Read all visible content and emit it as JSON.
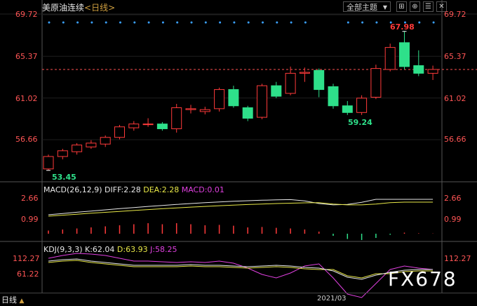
{
  "header": {
    "instrument": "美原油连续",
    "period": "<日线>",
    "theme_select": "全部主题",
    "tool_icons": [
      "grid-icon",
      "pin-icon",
      "list-icon",
      "close-icon"
    ]
  },
  "price_axis": {
    "left": [
      "69.72",
      "65.37",
      "61.02",
      "56.66"
    ],
    "right": [
      "69.72",
      "65.37",
      "61.02",
      "56.66"
    ]
  },
  "chart_data": {
    "type": "candlestick",
    "last_price_line": 64.0,
    "ylim": [
      51.0,
      69.72
    ],
    "annotations": {
      "high": "67.98",
      "low_1": "53.45",
      "low_2": "59.24"
    },
    "candles": [
      {
        "o": 53.6,
        "c": 54.9,
        "h": 55.1,
        "l": 53.45,
        "up": true
      },
      {
        "o": 54.9,
        "c": 55.5,
        "h": 55.7,
        "l": 54.6,
        "up": true
      },
      {
        "o": 55.4,
        "c": 56.1,
        "h": 56.3,
        "l": 55.1,
        "up": true
      },
      {
        "o": 55.9,
        "c": 56.3,
        "h": 56.6,
        "l": 55.7,
        "up": true
      },
      {
        "o": 56.2,
        "c": 56.9,
        "h": 57.1,
        "l": 55.9,
        "up": true
      },
      {
        "o": 56.9,
        "c": 58.0,
        "h": 58.2,
        "l": 56.7,
        "up": true
      },
      {
        "o": 57.9,
        "c": 58.3,
        "h": 58.6,
        "l": 57.6,
        "up": true
      },
      {
        "o": 58.3,
        "c": 58.3,
        "h": 58.9,
        "l": 58.0,
        "up": true
      },
      {
        "o": 58.3,
        "c": 57.8,
        "h": 58.5,
        "l": 57.6,
        "up": false
      },
      {
        "o": 57.8,
        "c": 60.0,
        "h": 60.4,
        "l": 57.4,
        "up": true
      },
      {
        "o": 59.8,
        "c": 59.9,
        "h": 60.3,
        "l": 59.4,
        "up": true
      },
      {
        "o": 59.6,
        "c": 59.8,
        "h": 60.1,
        "l": 59.3,
        "up": true
      },
      {
        "o": 59.9,
        "c": 61.9,
        "h": 62.1,
        "l": 59.6,
        "up": true
      },
      {
        "o": 61.9,
        "c": 60.2,
        "h": 62.3,
        "l": 60.0,
        "up": false
      },
      {
        "o": 60.0,
        "c": 58.9,
        "h": 60.2,
        "l": 58.6,
        "up": false
      },
      {
        "o": 59.0,
        "c": 62.3,
        "h": 62.5,
        "l": 58.8,
        "up": true
      },
      {
        "o": 62.3,
        "c": 61.2,
        "h": 62.7,
        "l": 61.0,
        "up": false
      },
      {
        "o": 61.5,
        "c": 63.6,
        "h": 64.3,
        "l": 61.3,
        "up": true
      },
      {
        "o": 63.6,
        "c": 63.7,
        "h": 64.2,
        "l": 62.7,
        "up": true
      },
      {
        "o": 63.9,
        "c": 61.9,
        "h": 64.1,
        "l": 61.1,
        "up": false
      },
      {
        "o": 62.2,
        "c": 60.2,
        "h": 62.5,
        "l": 59.9,
        "up": false
      },
      {
        "o": 60.2,
        "c": 59.5,
        "h": 60.7,
        "l": 59.24,
        "up": false
      },
      {
        "o": 59.5,
        "c": 61.0,
        "h": 61.3,
        "l": 59.24,
        "up": true
      },
      {
        "o": 61.1,
        "c": 64.1,
        "h": 64.5,
        "l": 60.9,
        "up": true
      },
      {
        "o": 64.0,
        "c": 66.3,
        "h": 66.7,
        "l": 63.8,
        "up": true
      },
      {
        "o": 64.3,
        "c": 66.8,
        "h": 67.98,
        "l": 64.0,
        "up": false
      },
      {
        "o": 64.4,
        "c": 63.6,
        "h": 66.0,
        "l": 63.3,
        "up": false
      },
      {
        "o": 63.6,
        "c": 64.0,
        "h": 64.4,
        "l": 62.9,
        "up": true
      }
    ],
    "macd": {
      "title": "MACD(26,12,9)",
      "diff": "DIFF:2.28",
      "dea": "DEA:2.28",
      "macd": "MACD:0.01",
      "axis": [
        "2.66",
        "0.99"
      ],
      "hist": [
        0.15,
        0.2,
        0.25,
        0.3,
        0.35,
        0.4,
        0.45,
        0.5,
        0.45,
        0.5,
        0.45,
        0.4,
        0.42,
        0.38,
        0.3,
        0.32,
        0.28,
        0.25,
        0.2,
        0.1,
        -0.1,
        -0.25,
        -0.3,
        -0.2,
        -0.05,
        0.05,
        0.02,
        0.01
      ]
    },
    "kdj": {
      "title": "KDJ(9,3,3)",
      "k": "K:62.04",
      "d": "D:63.93",
      "j": "J:58.25",
      "axis": [
        "112.27",
        "61.22"
      ]
    }
  },
  "footer": {
    "period_tab": "日线",
    "date": "2021/03",
    "watermark": "FX678"
  },
  "colors": {
    "up": "#ff3a3a",
    "down": "#2ee08a",
    "dots": "#3aa0ff",
    "last_line": "#ff5050",
    "diff": "#e8e8e8",
    "dea": "#e8e848",
    "j": "#e040e0"
  }
}
